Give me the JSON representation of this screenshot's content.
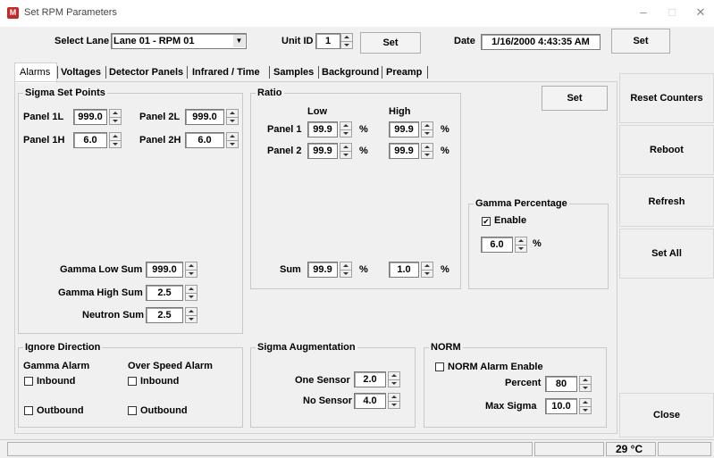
{
  "window": {
    "title": "Set RPM Parameters",
    "icon": "app-icon",
    "minimize": "–",
    "maximize": "□",
    "close": "✕"
  },
  "toolbar": {
    "lane_label": "Select Lane",
    "lane_value": "Lane 01 - RPM 01",
    "unit_label": "Unit ID",
    "unit_value": "1",
    "unit_set": "Set",
    "date_label": "Date",
    "date_value": "1/16/2000 4:43:35 AM",
    "date_set": "Set"
  },
  "tabs": [
    "Alarms",
    "Voltages",
    "Detector Panels",
    "Infrared / Time",
    "Samples",
    "Background",
    "Preamp"
  ],
  "sigma": {
    "title": "Sigma Set Points",
    "p1l_label": "Panel 1L",
    "p1l": "999.0",
    "p2l_label": "Panel 2L",
    "p2l": "999.0",
    "p1h_label": "Panel 1H",
    "p1h": "6.0",
    "p2h_label": "Panel 2H",
    "p2h": "6.0",
    "gls_label": "Gamma Low Sum",
    "gls": "999.0",
    "ghs_label": "Gamma High Sum",
    "ghs": "2.5",
    "ns_label": "Neutron Sum",
    "ns": "2.5"
  },
  "ratio": {
    "title": "Ratio",
    "low": "Low",
    "high": "High",
    "p1_label": "Panel 1",
    "p1_low": "99.9",
    "p1_high": "99.9",
    "p2_label": "Panel 2",
    "p2_low": "99.9",
    "p2_high": "99.9",
    "sum_label": "Sum",
    "sum_low": "99.9",
    "sum_high": "1.0",
    "pct": "%"
  },
  "main_set": "Set",
  "gamma_pct": {
    "title": "Gamma Percentage",
    "enable": "Enable",
    "enabled": true,
    "value": "6.0",
    "pct": "%"
  },
  "ignore": {
    "title": "Ignore Direction",
    "gamma": "Gamma Alarm",
    "overspeed": "Over Speed Alarm",
    "inbound": "Inbound",
    "outbound": "Outbound"
  },
  "augment": {
    "title": "Sigma Augmentation",
    "one_label": "One Sensor",
    "one": "2.0",
    "no_label": "No Sensor",
    "no": "4.0"
  },
  "norm": {
    "title": "NORM",
    "enable": "NORM Alarm Enable",
    "pct_label": "Percent",
    "pct": "80",
    "max_label": "Max Sigma",
    "max": "10.0"
  },
  "side": {
    "reset": "Reset Counters",
    "reboot": "Reboot",
    "refresh": "Refresh",
    "setall": "Set All",
    "close": "Close"
  },
  "status": {
    "temp": "29 °C"
  }
}
